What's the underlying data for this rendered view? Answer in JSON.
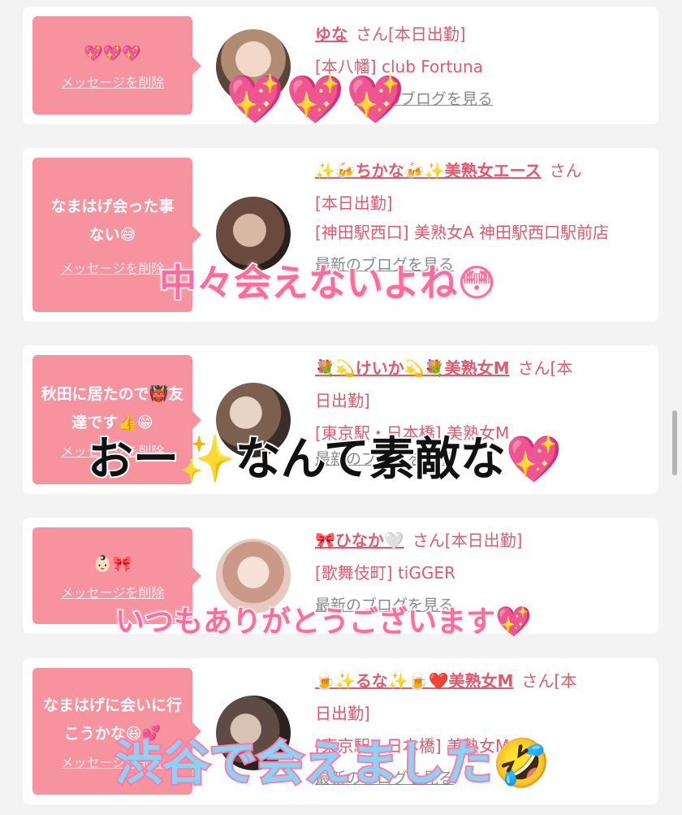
{
  "delete_label": "メッセージを削除",
  "blog_label": "最新のブログを見る",
  "cards": [
    {
      "message": "💖💖💖",
      "name": "ゆな",
      "suffix": "さん[本日出勤]",
      "line2": "[本八幡] club Fortuna",
      "line3": ""
    },
    {
      "message": "なまはげ会った事ない😅",
      "name": "✨🍻ちかな🍻✨美熟女エース",
      "suffix": "さん",
      "line2": "[本日出勤]",
      "line3": "[神田駅西口] 美熟女A 神田駅西口駅前店"
    },
    {
      "message": "秋田に居たので👹友達です👍😁",
      "name": "💐💫けいか💫💐美熟女M",
      "suffix": "さん[本",
      "line2": "日出勤]",
      "line3": "[東京駅・日本橋] 美熟女M"
    },
    {
      "message": "👶🏻🎀",
      "name": "🎀ひなか🤍",
      "suffix": "さん[本日出勤]",
      "line2": "[歌舞伎町] tiGGER",
      "line3": ""
    },
    {
      "message": "なまはげに会いに行こうかな😆💕",
      "name": "🍺✨るな✨🍺❤️美熟女M",
      "suffix": "さん[本",
      "line2": "日出勤]",
      "line3": "[東京駅・日本橋] 美熟女M"
    }
  ],
  "overlays": {
    "hearts": "💖💖💖",
    "caption1": "中々会えないよね😳",
    "caption2": "おー✨なんて素敵な💖",
    "caption3": "いつもありがとうございます💖",
    "caption4": "渋谷で会えました🤣"
  },
  "colors": {
    "bubble": "#f7929f",
    "name_text": "#e15a6d",
    "background": "#f3f3f3"
  }
}
